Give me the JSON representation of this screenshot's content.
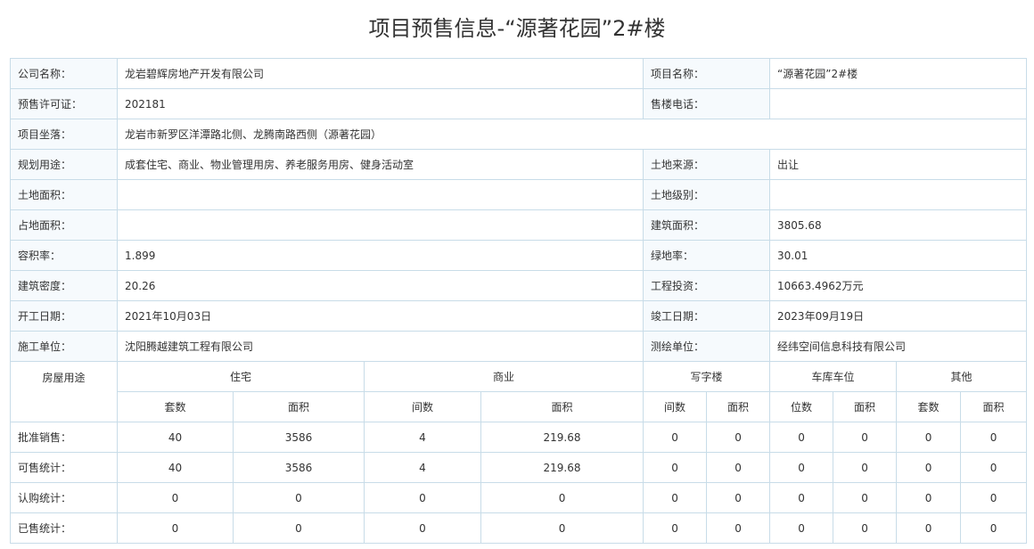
{
  "title": "项目预售信息-“源著花园”2#楼",
  "info": {
    "company_label": "公司名称：",
    "company": "龙岩碧辉房地产开发有限公司",
    "project_label": "项目名称：",
    "project": "“源著花园”2#楼",
    "permit_label": "预售许可证：",
    "permit": "202181",
    "phone_label": "售楼电话：",
    "phone": "",
    "location_label": "项目坐落：",
    "location": "龙岩市新罗区洋潭路北侧、龙腾南路西侧（源著花园）",
    "usage_label": "规划用途：",
    "usage": "成套住宅、商业、物业管理用房、养老服务用房、健身活动室",
    "land_source_label": "土地来源：",
    "land_source": "出让",
    "land_area_label": "土地面积：",
    "land_area": "",
    "land_level_label": "土地级别：",
    "land_level": "",
    "occupied_label": "占地面积：",
    "occupied": "",
    "build_area_label": "建筑面积：",
    "build_area": "3805.68",
    "far_label": "容积率：",
    "far": "1.899",
    "green_label": "绿地率：",
    "green": "30.01",
    "density_label": "建筑密度：",
    "density": "20.26",
    "invest_label": "工程投资：",
    "invest": "10663.4962万元",
    "start_label": "开工日期：",
    "start": "2021年10月03日",
    "finish_label": "竣工日期：",
    "finish": "2023年09月19日",
    "builder_label": "施工单位：",
    "builder": "沈阳腾越建筑工程有限公司",
    "surveyor_label": "测绘单位：",
    "surveyor": "经纬空间信息科技有限公司"
  },
  "stats": {
    "usage_header": "房屋用途",
    "groups": [
      "住宅",
      "商业",
      "写字楼",
      "车库车位",
      "其他"
    ],
    "subheaders": [
      "套数",
      "面积",
      "间数",
      "面积",
      "间数",
      "面积",
      "位数",
      "面积",
      "套数",
      "面积"
    ],
    "rows": [
      {
        "label": "批准销售：",
        "values": [
          "40",
          "3586",
          "4",
          "219.68",
          "0",
          "0",
          "0",
          "0",
          "0",
          "0"
        ]
      },
      {
        "label": "可售统计：",
        "values": [
          "40",
          "3586",
          "4",
          "219.68",
          "0",
          "0",
          "0",
          "0",
          "0",
          "0"
        ]
      },
      {
        "label": "认购统计：",
        "values": [
          "0",
          "0",
          "0",
          "0",
          "0",
          "0",
          "0",
          "0",
          "0",
          "0"
        ]
      },
      {
        "label": "已售统计：",
        "values": [
          "0",
          "0",
          "0",
          "0",
          "0",
          "0",
          "0",
          "0",
          "0",
          "0"
        ]
      }
    ]
  }
}
